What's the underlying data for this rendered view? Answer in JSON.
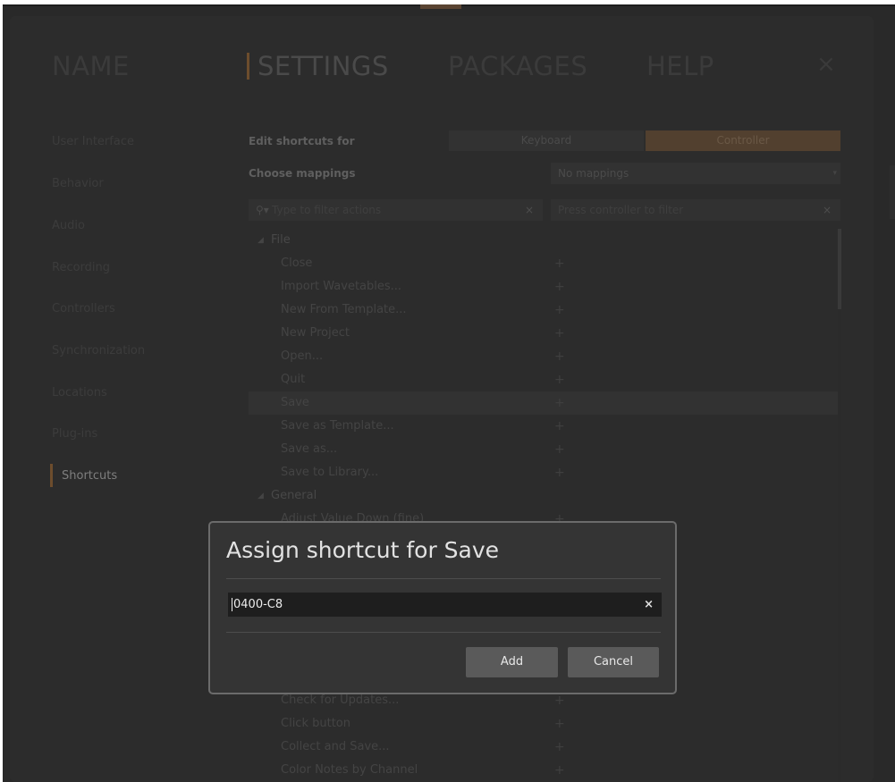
{
  "nav": {
    "tabs": [
      {
        "label": "NAME"
      },
      {
        "label": "SETTINGS"
      },
      {
        "label": "PACKAGES"
      },
      {
        "label": "HELP"
      }
    ],
    "close_glyph": "×"
  },
  "sidebar": {
    "items": [
      {
        "label": "User Interface"
      },
      {
        "label": "Behavior"
      },
      {
        "label": "Audio"
      },
      {
        "label": "Recording"
      },
      {
        "label": "Controllers"
      },
      {
        "label": "Synchronization"
      },
      {
        "label": "Locations"
      },
      {
        "label": "Plug-ins"
      },
      {
        "label": "Shortcuts"
      }
    ],
    "active_index": 8
  },
  "shortcuts": {
    "edit_for_label": "Edit shortcuts for",
    "edit_for_options": [
      "Keyboard",
      "Controller"
    ],
    "edit_for_selected": "Controller",
    "mappings_label": "Choose mappings",
    "mappings_value": "No mappings",
    "filter_actions_placeholder": "Type to filter actions",
    "filter_controller_placeholder": "Press controller to filter",
    "clear_glyph": "×",
    "tree": {
      "file_group": "File",
      "file_items": [
        "Close",
        "Import Wavetables...",
        "New From Template...",
        "New Project",
        "Open...",
        "Quit",
        "Save",
        "Save as Template...",
        "Save as...",
        "Save to Library..."
      ],
      "general_group": "General",
      "general_items": [
        "Adjust Value Down (fine)"
      ],
      "general_items_below": [
        "Check for Updates...",
        "Click button",
        "Collect and Save...",
        "Color Notes by Channel"
      ],
      "selected_item": "Save"
    }
  },
  "dialog": {
    "title": "Assign shortcut for Save",
    "input_value": "0400-C8",
    "clear_glyph": "×",
    "add_label": "Add",
    "cancel_label": "Cancel"
  }
}
